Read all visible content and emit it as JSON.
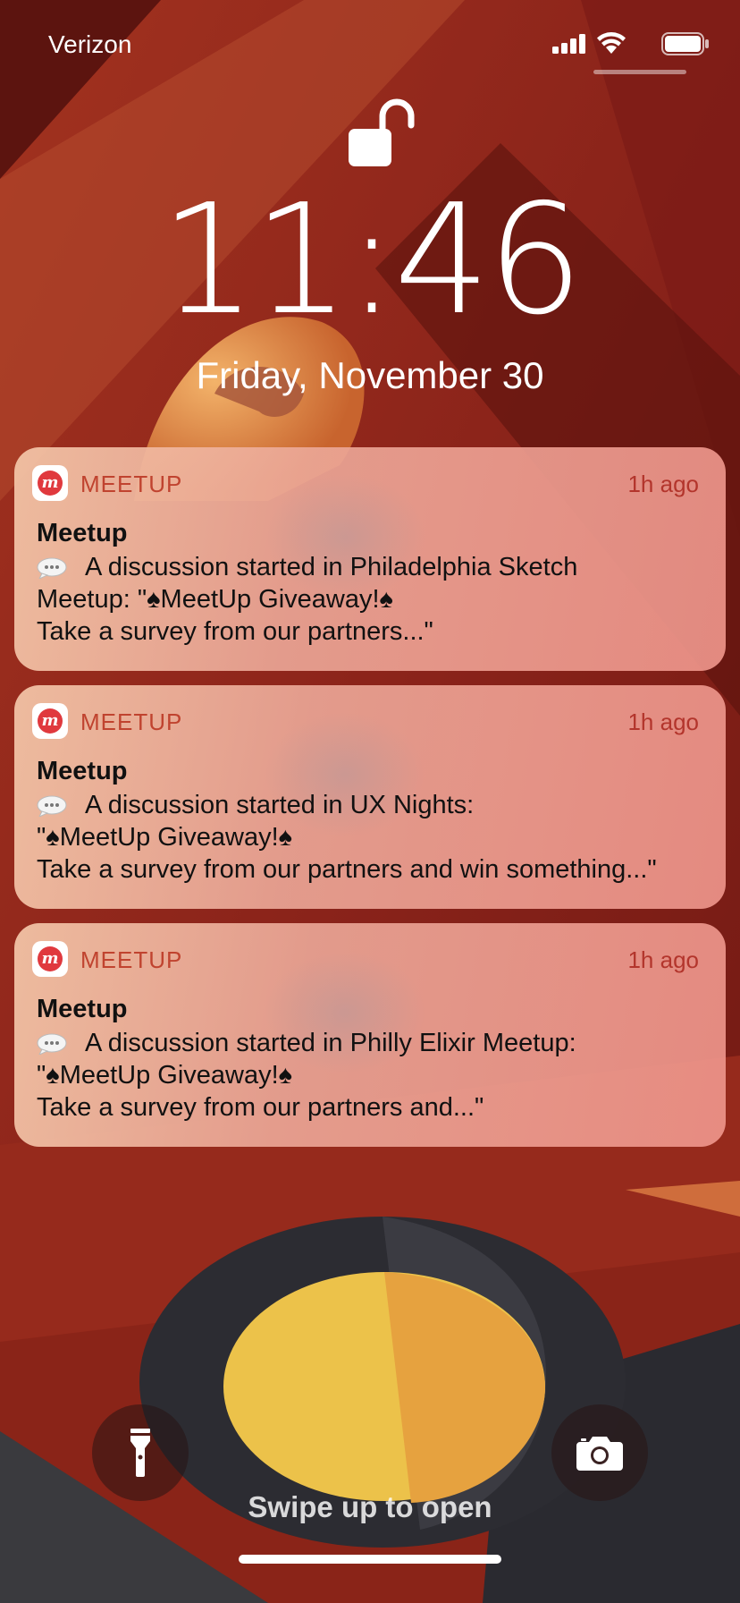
{
  "status_bar": {
    "carrier": "Verizon",
    "signal_icon": "signal-icon",
    "wifi_icon": "wifi-icon",
    "battery_icon": "battery-icon"
  },
  "lock_screen": {
    "lock_icon": "unlocked-padlock-icon",
    "time": "11:46",
    "date": "Friday, November 30"
  },
  "notifications": [
    {
      "app": "MEETUP",
      "time_ago": "1h ago",
      "title": "Meetup",
      "lines": [
        "A discussion started in Philadelphia Sketch",
        "Meetup: \"♠MeetUp Giveaway!♠",
        "Take a survey from our partners...\""
      ]
    },
    {
      "app": "MEETUP",
      "time_ago": "1h ago",
      "title": "Meetup",
      "lines": [
        "A discussion started in UX Nights:",
        "\"♠MeetUp Giveaway!♠",
        "Take a survey from our partners and win something...\""
      ]
    },
    {
      "app": "MEETUP",
      "time_ago": "1h ago",
      "title": "Meetup",
      "lines": [
        "A discussion started in Philly Elixir Meetup:",
        "\"♠MeetUp Giveaway!♠",
        "Take a survey from our partners and...\""
      ]
    }
  ],
  "bottom": {
    "flashlight_icon": "flashlight-icon",
    "camera_icon": "camera-icon",
    "swipe_hint": "Swipe up to open"
  },
  "colors": {
    "accent": "#c0432f",
    "meetup_red": "#e0393e"
  }
}
